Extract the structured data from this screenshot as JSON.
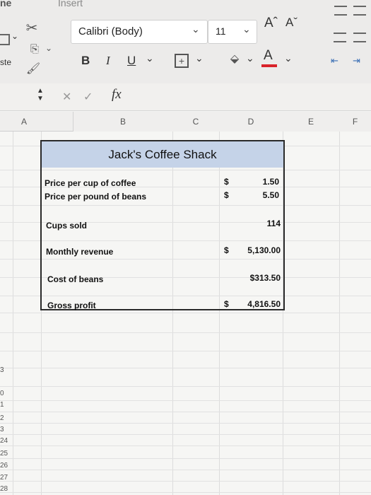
{
  "ribbon": {
    "tab_home_partial": "ne",
    "tab_insert": "Insert",
    "paste_label_partial": "ste",
    "font_name": "Calibri (Body)",
    "font_size": "11",
    "bold": "B",
    "italic": "I",
    "underline": "U",
    "increase_font": "Aˆ",
    "decrease_font": "Aˇ",
    "font_color": "A"
  },
  "formula_bar": {
    "fx": "fx",
    "cancel": "✕",
    "enter": "✓"
  },
  "columns": [
    "A",
    "B",
    "C",
    "D",
    "E",
    "F"
  ],
  "row_numbers": [
    "3",
    "0",
    "1",
    "2",
    "3",
    "24",
    "25",
    "26",
    "27",
    "28"
  ],
  "sheet": {
    "title": "Jack's Coffee Shack",
    "rows": [
      {
        "label": "Price per cup of coffee",
        "dollar": "$",
        "value": "1.50"
      },
      {
        "label": "Price per pound of beans",
        "dollar": "$",
        "value": "5.50"
      },
      {
        "label": "Cups sold",
        "dollar": "",
        "value": "114"
      },
      {
        "label": "Monthly revenue",
        "dollar": "$",
        "value": "5,130.00"
      },
      {
        "label": "Cost of beans",
        "dollar": "",
        "value": "$313.50"
      },
      {
        "label": "Gross profit",
        "dollar": "$",
        "value": "4,816.50"
      }
    ]
  },
  "colors": {
    "title_fill": "#c5d3e8",
    "font_color_bar": "#d9232a"
  }
}
